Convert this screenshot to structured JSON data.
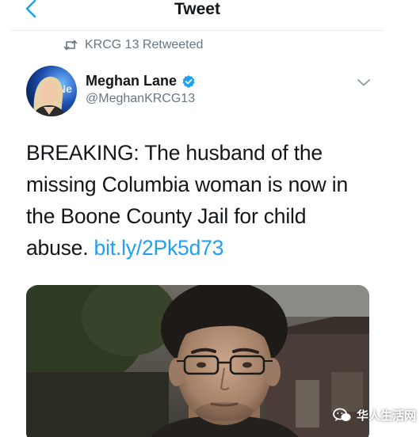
{
  "header": {
    "title": "Tweet",
    "back_icon": "chevron-left-icon"
  },
  "retweet": {
    "label": "KRCG 13 Retweeted",
    "icon": "retweet-icon"
  },
  "author": {
    "name": "Meghan Lane",
    "handle": "@MeghanKRCG13",
    "verified": true,
    "avatar_icon": "avatar"
  },
  "tweet": {
    "line1": "BREAKING: The husband of the",
    "line2": "missing Columbia woman is now in",
    "line3": "the Boone County Jail for child",
    "line4_prefix": "abuse. ",
    "link": "bit.ly/2Pk5d73"
  },
  "media": {
    "type": "photo"
  },
  "watermark": {
    "text": "华人生活网",
    "icon": "wechat-icon"
  },
  "colors": {
    "accent": "#1da1f2",
    "text": "#14171a",
    "muted": "#657786",
    "divider": "#e6ecf0"
  }
}
